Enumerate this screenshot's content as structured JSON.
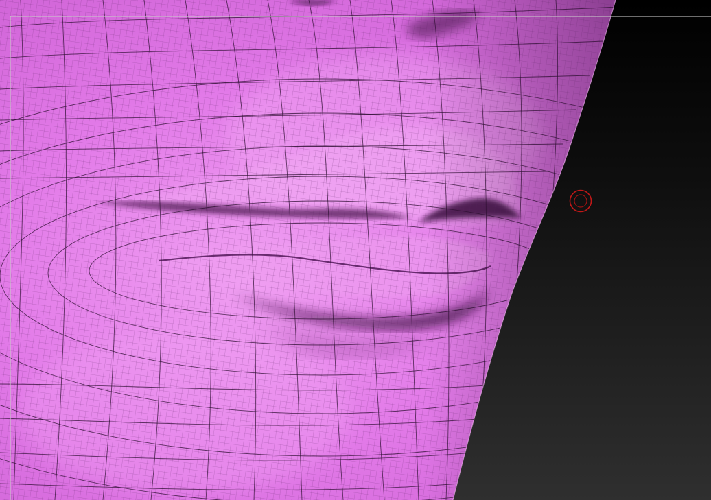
{
  "app": {
    "type": "3D sculpting viewport"
  },
  "scene": {
    "subject": "mouth-and-nose-mesh",
    "mesh_color": "#e27ae8",
    "mesh_highlight": "#f3a6f5",
    "mesh_shadow": "#7a2f7f",
    "wire_color": "#3a153c",
    "background_top": "#000000",
    "background_bottom": "#2e2e2e"
  },
  "cursor": {
    "icon": "brush-cursor-icon",
    "color": "#c01818"
  }
}
